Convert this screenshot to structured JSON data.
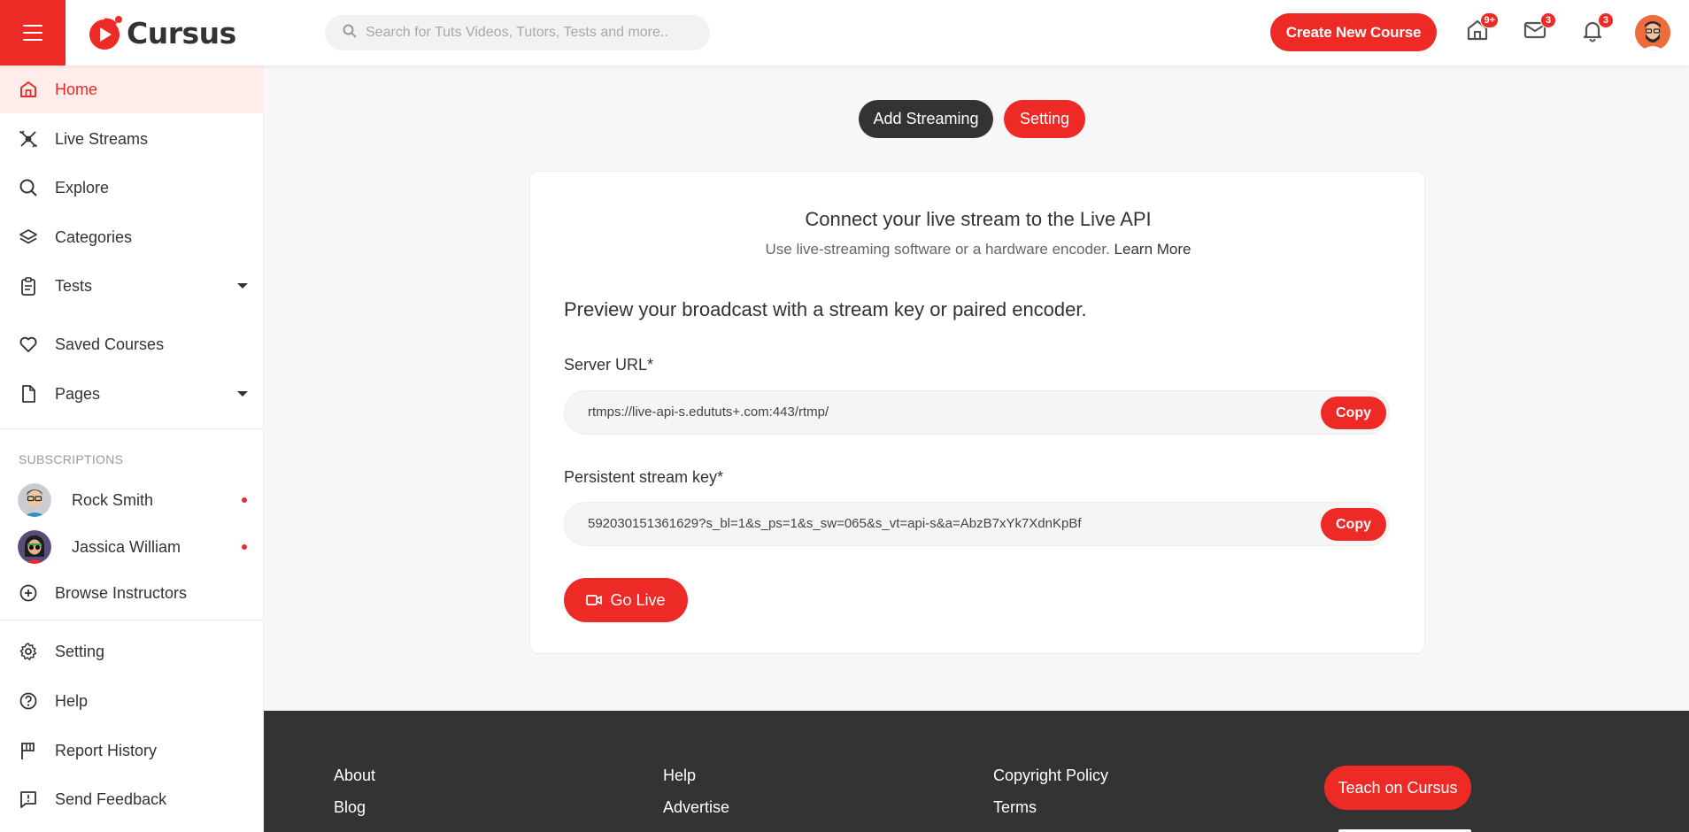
{
  "header": {
    "app_name": "Cursus",
    "search_placeholder": "Search for Tuts Videos, Tutors, Tests and more..",
    "create_button": "Create New Course",
    "badges": {
      "home": "9+",
      "messages": "3",
      "notifications": "3"
    },
    "icons": [
      "menu-icon",
      "search-icon",
      "home-icon",
      "mail-icon",
      "bell-icon"
    ]
  },
  "sidebar": {
    "items": [
      {
        "label": "Home",
        "icon": "home-icon",
        "active": true
      },
      {
        "label": "Live Streams",
        "icon": "live-streams-icon"
      },
      {
        "label": "Explore",
        "icon": "search-icon"
      },
      {
        "label": "Categories",
        "icon": "layers-icon"
      },
      {
        "label": "Tests",
        "icon": "clipboard-icon",
        "has_dropdown": true
      },
      {
        "label": "Saved Courses",
        "icon": "heart-icon"
      },
      {
        "label": "Pages",
        "icon": "file-icon",
        "has_dropdown": true
      }
    ],
    "subscriptions_heading": "SUBSCRIPTIONS",
    "subscriptions": [
      {
        "name": "Rock Smith"
      },
      {
        "name": "Jassica William"
      }
    ],
    "browse_instructors": "Browse Instructors",
    "bottom_items": [
      {
        "label": "Setting",
        "icon": "gear-icon"
      },
      {
        "label": "Help",
        "icon": "help-icon"
      },
      {
        "label": "Report History",
        "icon": "flag-icon"
      },
      {
        "label": "Send Feedback",
        "icon": "feedback-icon"
      }
    ]
  },
  "tabs": {
    "add_streaming": "Add Streaming",
    "setting": "Setting"
  },
  "stream_card": {
    "title": "Connect your live stream to the Live API",
    "subtitle": "Use live-streaming software or a hardware encoder.",
    "learn_more": "Learn More",
    "preview_heading": "Preview your broadcast with a stream key or paired encoder.",
    "server_url_label": "Server URL*",
    "server_url_value": "rtmps://live-api-s.edututs+.com:443/rtmp/",
    "stream_key_label": "Persistent stream key*",
    "stream_key_value": "592030151361629?s_bl=1&s_ps=1&s_sw=065&s_vt=api-s&a=AbzB7xYk7XdnKpBf",
    "copy_label": "Copy",
    "go_live": "Go Live"
  },
  "footer": {
    "links": [
      "About",
      "Blog",
      "Help",
      "Advertise",
      "Copyright Policy",
      "Terms"
    ],
    "teach_button": "Teach on Cursus"
  },
  "colors": {
    "accent": "#ed2a26",
    "dark": "#333333",
    "active_bg": "#ffeceb",
    "page_bg": "#f7f7f7"
  }
}
